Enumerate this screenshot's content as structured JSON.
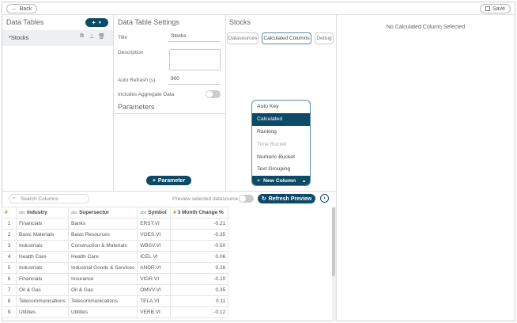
{
  "topbar": {
    "back_label": "Back",
    "save_label": "Save"
  },
  "data_tables": {
    "title": "Data Tables",
    "items": [
      {
        "label": "*Stocks"
      }
    ]
  },
  "settings": {
    "title": "Data Table Settings",
    "title_label": "Title",
    "title_value": "Stocks",
    "description_label": "Description",
    "description_value": "",
    "auto_refresh_label": "Auto Refresh (s)",
    "auto_refresh_value": "900",
    "aggregate_label": "Includes Aggregate Data",
    "aggregate_on": false,
    "parameters_title": "Parameters",
    "add_parameter_label": "Parameter"
  },
  "stocks": {
    "title": "Stocks",
    "tabs": [
      {
        "label": "Datasources"
      },
      {
        "label": "Calculated Columns",
        "active": true
      },
      {
        "label": "Debug"
      }
    ],
    "menu": [
      {
        "label": "Auto Key"
      },
      {
        "label": "Calculated",
        "selected": true
      },
      {
        "label": "Ranking"
      },
      {
        "label": "Time Bucket",
        "disabled": true
      },
      {
        "label": "Numeric Bucket"
      },
      {
        "label": "Text Grouping"
      }
    ],
    "new_column_label": "New Column"
  },
  "right": {
    "empty_text": "No Calculated Column Selected"
  },
  "preview": {
    "search_placeholder": "Search Columns",
    "preview_label": "Preview selected datasource",
    "preview_on": false,
    "refresh_label": "Refresh Preview",
    "columns": [
      {
        "type": "#",
        "label": ""
      },
      {
        "type": "abc",
        "label": "Industry"
      },
      {
        "type": "abc",
        "label": "Supersector"
      },
      {
        "type": "abc",
        "label": "Symbol"
      },
      {
        "type": "#",
        "label": "3 Month Change %"
      }
    ],
    "rows": [
      [
        "1",
        "Financials",
        "Banks",
        "ERST.VI",
        "-0.21"
      ],
      [
        "2",
        "Basic Materials",
        "Basic Resources",
        "VOES.VI",
        "-0.35"
      ],
      [
        "3",
        "Industrials",
        "Construction & Materials",
        "WBSV.VI",
        "-0.50"
      ],
      [
        "4",
        "Health Care",
        "Health Care",
        "ICEL.VI",
        "0.06"
      ],
      [
        "5",
        "Industrials",
        "Industrial Goods & Services",
        "ANDR.VI",
        "0.28"
      ],
      [
        "6",
        "Financials",
        "Insurance",
        "VIGR.VI",
        "-0.10"
      ],
      [
        "7",
        "Oil & Gas",
        "Oil & Gas",
        "OMVV.VI",
        "0.35"
      ],
      [
        "8",
        "Telecommunications",
        "Telecommunications",
        "TELA.VI",
        "0.11"
      ],
      [
        "9",
        "Utilities",
        "Utilities",
        "VERB.VI",
        "-0.12"
      ]
    ]
  },
  "colors": {
    "accent": "#0d4a68",
    "numeric": "#e05a2b",
    "text_type": "#5b8bd6"
  }
}
